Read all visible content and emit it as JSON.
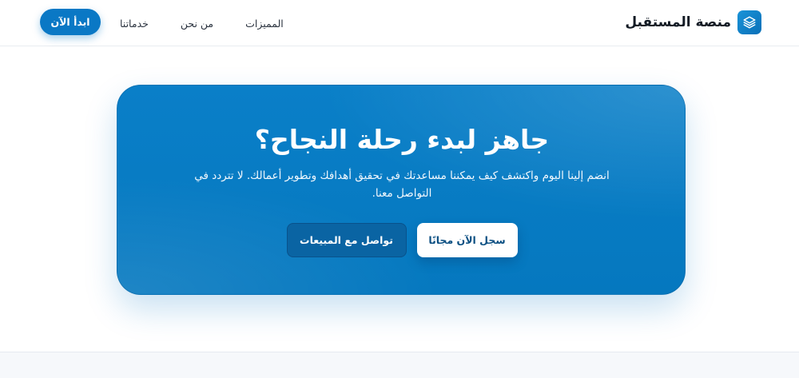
{
  "brand": {
    "name": "منصة المستقبل",
    "icon": "layers-icon"
  },
  "nav": {
    "links": [
      {
        "label": "المميزات"
      },
      {
        "label": "من نحن"
      },
      {
        "label": "خدماتنا"
      }
    ],
    "cta_label": "ابدأ الآن"
  },
  "cta": {
    "title": "جاهز لبدء رحلة النجاح؟",
    "description": "انضم إلينا اليوم واكتشف كيف يمكننا مساعدتك في تحقيق أهدافك وتطوير أعمالك. لا تتردد في التواصل معنا.",
    "primary_button": "سجل الآن مجانًا",
    "secondary_button": "تواصل مع المبيعات"
  },
  "colors": {
    "accent": "#0a78c5",
    "card_bg": "#0a7fc8",
    "text_dark": "#121a24"
  }
}
